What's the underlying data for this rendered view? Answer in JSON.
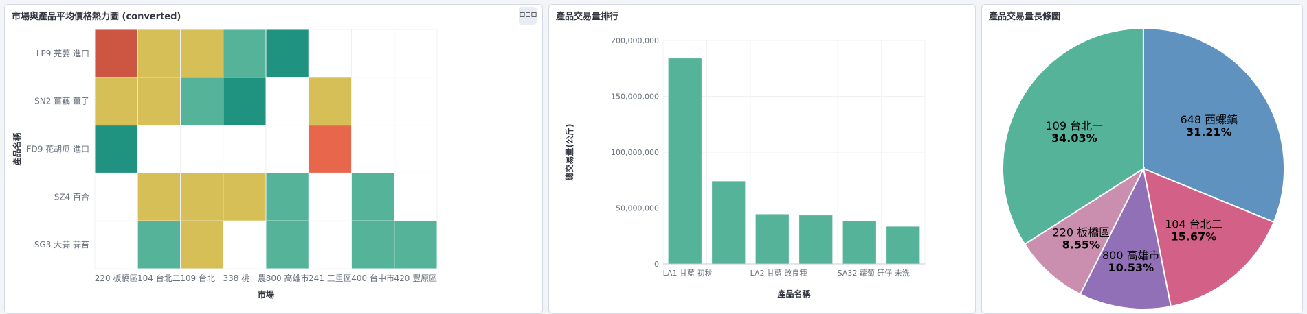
{
  "panels": {
    "heatmap": {
      "title": "市場與產品平均價格熱力圖 (converted)",
      "options_icon": "horizontal-ellipsis"
    },
    "bar": {
      "title": "產品交易量排行"
    },
    "pie": {
      "title": "產品交易量長條圖"
    }
  },
  "chart_data": [
    {
      "type": "heatmap",
      "xlabel": "市場",
      "ylabel": "產品名稱",
      "x_categories": [
        "220 板橋區",
        "104 台北二",
        "109 台北一",
        "338 桃　農",
        "800 高雄市",
        "241 三重區",
        "400 台中市",
        "420 豐原區"
      ],
      "y_categories": [
        "LP9 芫荽 進口",
        "SN2 薑藕 薑子",
        "FD9 花胡瓜 進口",
        "SZ4 百合",
        "SG3 大蒜 蒜苔"
      ],
      "cells": [
        [
          {
            "level": 5,
            "color": "#cc5642"
          },
          {
            "level": 3,
            "color": "#d6bf57"
          },
          {
            "level": 3,
            "color": "#d6bf57"
          },
          {
            "level": 2,
            "color": "#54b399"
          },
          {
            "level": 1,
            "color": "#209280"
          },
          null,
          null,
          null
        ],
        [
          {
            "level": 3,
            "color": "#d6bf57"
          },
          {
            "level": 3,
            "color": "#d6bf57"
          },
          {
            "level": 2,
            "color": "#54b399"
          },
          {
            "level": 1,
            "color": "#209280"
          },
          null,
          {
            "level": 3,
            "color": "#d6bf57"
          },
          null,
          null
        ],
        [
          {
            "level": 1,
            "color": "#209280"
          },
          null,
          null,
          null,
          null,
          {
            "level": 4,
            "color": "#e7664c"
          },
          null,
          null
        ],
        [
          null,
          {
            "level": 3,
            "color": "#d6bf57"
          },
          {
            "level": 3,
            "color": "#d6bf57"
          },
          {
            "level": 3,
            "color": "#d6bf57"
          },
          {
            "level": 2,
            "color": "#54b399"
          },
          null,
          {
            "level": 2,
            "color": "#54b399"
          },
          null
        ],
        [
          null,
          {
            "level": 2,
            "color": "#54b399"
          },
          {
            "level": 3,
            "color": "#d6bf57"
          },
          null,
          {
            "level": 2,
            "color": "#54b399"
          },
          null,
          {
            "level": 2,
            "color": "#54b399"
          },
          {
            "level": 2,
            "color": "#54b399"
          }
        ]
      ]
    },
    {
      "type": "bar",
      "xlabel": "產品名稱",
      "ylabel": "總交易量(公斤)",
      "ylim": [
        0,
        200000000
      ],
      "yticks": [
        0,
        50000000,
        100000000,
        150000000,
        200000000
      ],
      "ytick_labels": [
        "0",
        "50,000,000",
        "100,000,000",
        "150,000,000",
        "200,000,000"
      ],
      "categories": [
        "LA1 甘藍 初秋",
        "",
        "LA2 甘藍 改良種",
        "",
        "SA32 蘿蔔 矸仔 未洗",
        ""
      ],
      "values": [
        184000000,
        74000000,
        44500000,
        43500000,
        38500000,
        33500000
      ],
      "color": "#54b399",
      "grid": true
    },
    {
      "type": "pie",
      "slices": [
        {
          "label": "648 西螺鎮",
          "percent": 31.21,
          "value_label": "31.21%",
          "color": "#6092c0"
        },
        {
          "label": "104 台北二",
          "percent": 15.67,
          "value_label": "15.67%",
          "color": "#d36086"
        },
        {
          "label": "800 高雄市",
          "percent": 10.53,
          "value_label": "10.53%",
          "color": "#9170b8"
        },
        {
          "label": "220 板橋區",
          "percent": 8.55,
          "value_label": "8.55%",
          "color": "#ca8eae"
        },
        {
          "label": "109 台北一",
          "percent": 34.03,
          "value_label": "34.03%",
          "color": "#54b399"
        }
      ]
    }
  ]
}
